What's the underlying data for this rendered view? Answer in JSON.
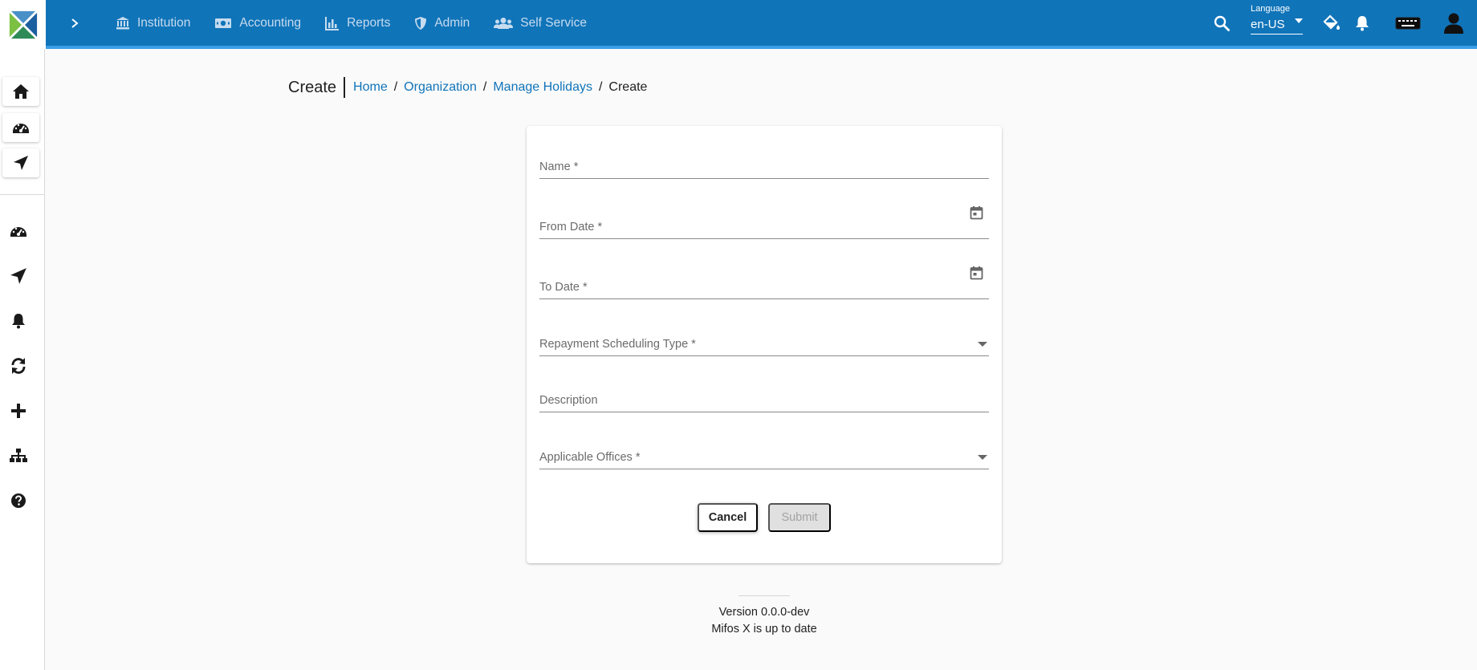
{
  "topbar": {
    "nav": [
      {
        "label": "Institution",
        "icon": "bank-icon"
      },
      {
        "label": "Accounting",
        "icon": "money-icon"
      },
      {
        "label": "Reports",
        "icon": "bar-chart-icon"
      },
      {
        "label": "Admin",
        "icon": "shield-icon"
      },
      {
        "label": "Self Service",
        "icon": "users-icon"
      }
    ],
    "language": {
      "label": "Language",
      "value": "en-US"
    }
  },
  "breadcrumb": {
    "title": "Create",
    "links": [
      "Home",
      "Organization",
      "Manage Holidays"
    ],
    "current": "Create"
  },
  "form": {
    "name_label": "Name *",
    "from_date_label": "From Date *",
    "to_date_label": "To Date *",
    "repayment_label": "Repayment Scheduling Type *",
    "description_label": "Description",
    "offices_label": "Applicable Offices *",
    "cancel_label": "Cancel",
    "submit_label": "Submit"
  },
  "footer": {
    "version": "Version 0.0.0-dev",
    "status": "Mifos X is up to date"
  },
  "colors": {
    "primary": "#1074b9",
    "accent_bar": "#3b9ee8",
    "link": "#1074b9"
  }
}
